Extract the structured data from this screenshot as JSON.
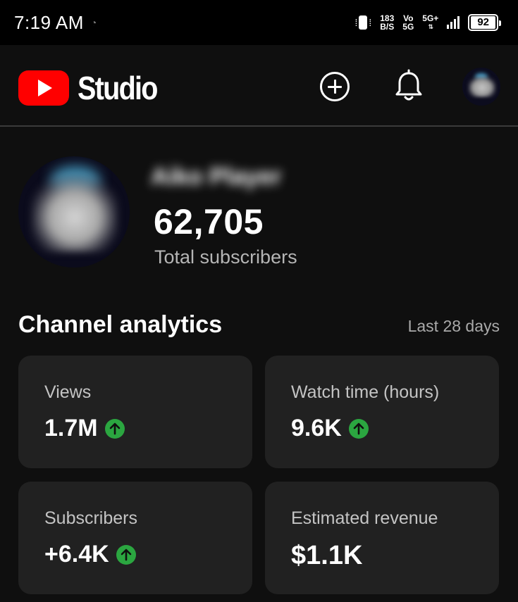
{
  "status_bar": {
    "time": "7:19 AM",
    "data_speed_value": "183",
    "data_speed_unit": "B/S",
    "volte_top": "Vo",
    "volte_bottom": "5G",
    "network": "5G+",
    "battery": "92"
  },
  "app_bar": {
    "title": "Studio"
  },
  "channel": {
    "name": "Aiko Player",
    "subscriber_count": "62,705",
    "subscriber_label": "Total subscribers"
  },
  "analytics": {
    "title": "Channel analytics",
    "period": "Last 28 days",
    "cards": [
      {
        "label": "Views",
        "value": "1.7M",
        "trend": "up"
      },
      {
        "label": "Watch time (hours)",
        "value": "9.6K",
        "trend": "up"
      },
      {
        "label": "Subscribers",
        "value": "+6.4K",
        "trend": "up"
      },
      {
        "label": "Estimated revenue",
        "value": "$1.1K",
        "trend": "none"
      }
    ]
  },
  "colors": {
    "background": "#0f0f0f",
    "card": "#212121",
    "youtube_red": "#ff0000",
    "trend_up": "#2ba640",
    "muted_text": "#aaaaaa"
  }
}
